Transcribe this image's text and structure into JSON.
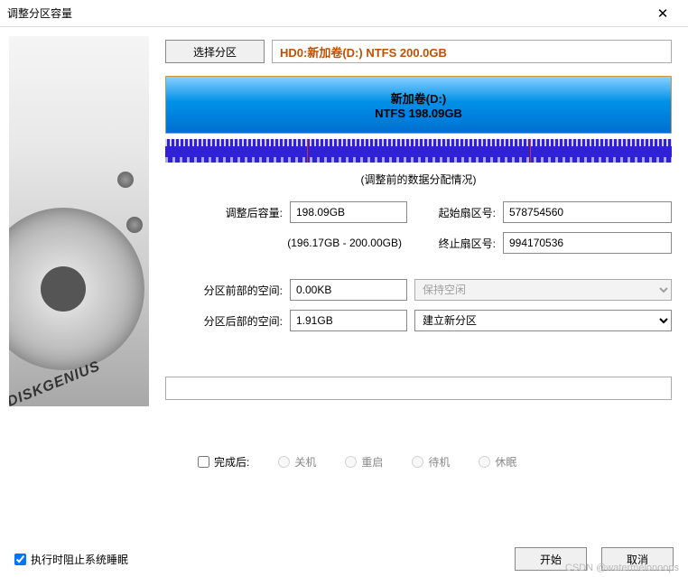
{
  "window": {
    "title": "调整分区容量"
  },
  "side": {
    "brand": "DISKGENIUS"
  },
  "top": {
    "select_btn": "选择分区",
    "partition_info": "HD0:新加卷(D:) NTFS 200.0GB"
  },
  "visual": {
    "name": "新加卷(D:)",
    "fs_size": "NTFS 198.09GB"
  },
  "caption": "(调整前的数据分配情况)",
  "labels": {
    "after_size": "调整后容量:",
    "start_sector": "起始扇区号:",
    "end_sector": "终止扇区号:",
    "range_note": "(196.17GB - 200.00GB)",
    "space_before": "分区前部的空间:",
    "space_after": "分区后部的空间:"
  },
  "values": {
    "after_size": "198.09GB",
    "start_sector": "578754560",
    "end_sector": "994170536",
    "space_before": "0.00KB",
    "space_after": "1.91GB"
  },
  "options": {
    "keep_free": "保持空闲",
    "new_partition": "建立新分区"
  },
  "bottom": {
    "on_complete": "完成后:",
    "shutdown": "关机",
    "restart": "重启",
    "standby": "待机",
    "hibernate": "休眠"
  },
  "footer": {
    "prevent_sleep": "执行时阻止系统睡眠",
    "start": "开始",
    "cancel": "取消"
  },
  "watermark": "CSDN @watermelonoops"
}
